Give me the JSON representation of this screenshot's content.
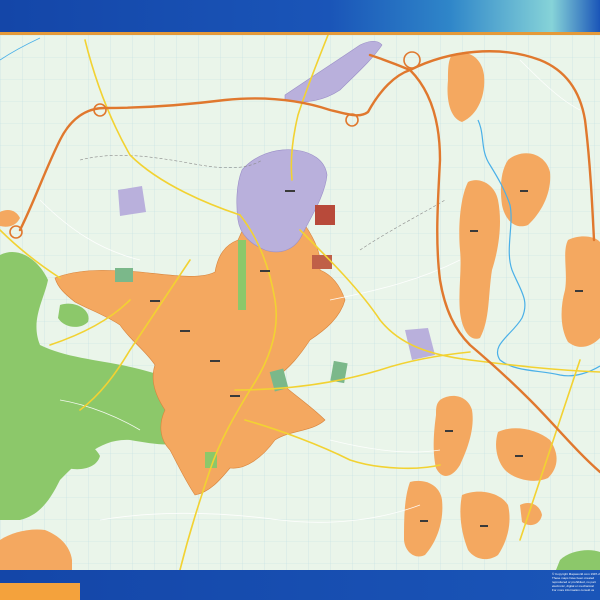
{
  "map": {
    "type": "street-map",
    "grid": true,
    "colors": {
      "header": "#1a55b8",
      "header_accent": "#86d3d8",
      "divider": "#e49a3a",
      "background": "#eaf5ea",
      "grid": "#bfe0e4",
      "urban": "#f4a860",
      "urban_outline": "#d8843c",
      "industrial": "#b9b0dc",
      "forest": "#8cc86a",
      "motorway": "#e0782e",
      "main_road": "#f2d232",
      "river": "#4ab0e8",
      "footer_tab": "#f4a23c"
    }
  },
  "copyright": {
    "lines": [
      "© Copyright Mapsworld.com 1997-2019",
      "These maps have been created",
      "reproduced or prohibited, no part",
      "electronic, digital or mechanical",
      "For more information consult us"
    ]
  }
}
